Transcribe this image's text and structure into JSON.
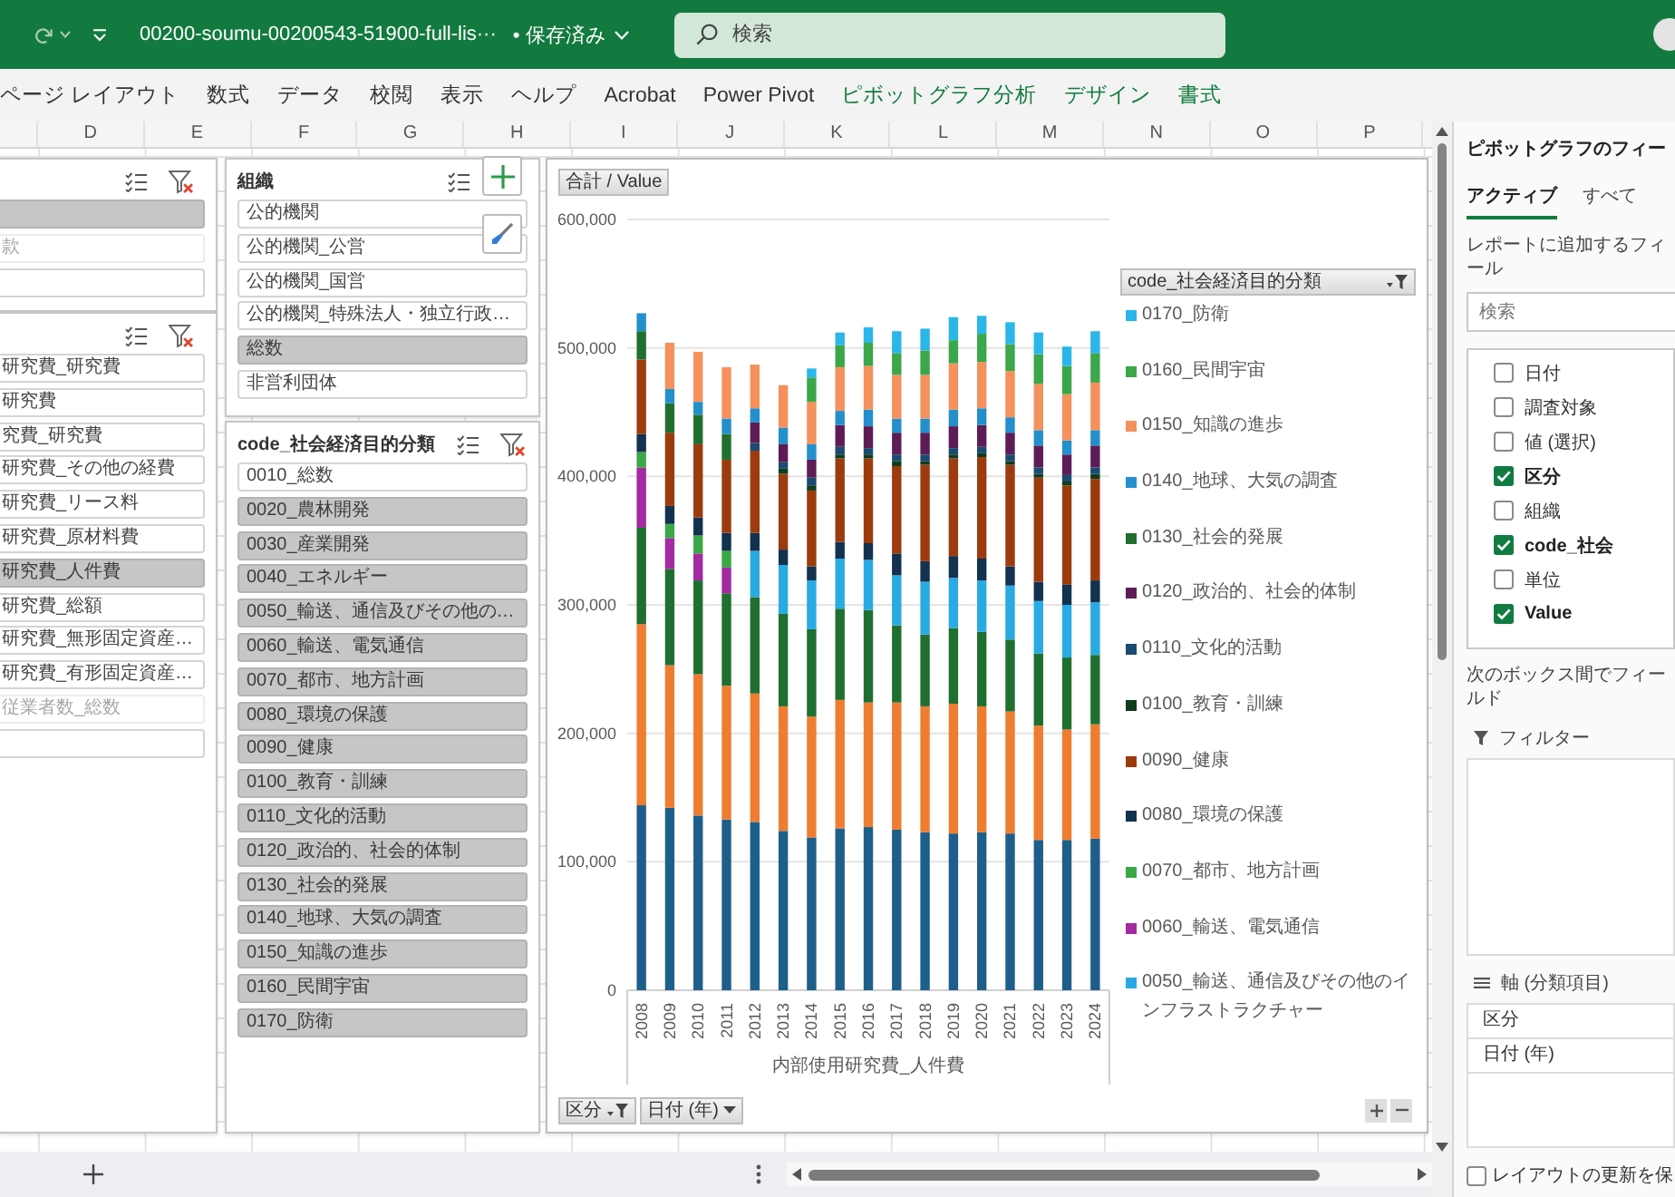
{
  "title_bar": {
    "file_name": "00200-soumu-00200543-51900-full-lis···",
    "save_status": "• 保存済み",
    "search": {
      "placeholder": "検索"
    }
  },
  "ribbon_tabs": [
    {
      "label": "ページ レイアウト",
      "contextual": false
    },
    {
      "label": "数式",
      "contextual": false
    },
    {
      "label": "データ",
      "contextual": false
    },
    {
      "label": "校閲",
      "contextual": false
    },
    {
      "label": "表示",
      "contextual": false
    },
    {
      "label": "ヘルプ",
      "contextual": false
    },
    {
      "label": "Acrobat",
      "contextual": false
    },
    {
      "label": "Power Pivot",
      "contextual": false
    },
    {
      "label": "ピボットグラフ分析",
      "contextual": true
    },
    {
      "label": "デザイン",
      "contextual": true
    },
    {
      "label": "書式",
      "contextual": true
    }
  ],
  "column_headers": [
    "D",
    "E",
    "F",
    "G",
    "H",
    "I",
    "J",
    "K",
    "L",
    "M",
    "N",
    "O",
    "P"
  ],
  "slicers": [
    {
      "items": [
        {
          "selected": true,
          "has_data": true
        },
        {
          "label": "款",
          "selected": false,
          "has_data": false
        },
        {
          "selected": false,
          "has_data": true
        }
      ]
    },
    {
      "items": [
        {
          "label": "研究費_研究費",
          "selected": false,
          "has_data": true
        },
        {
          "label": "研究費",
          "selected": false,
          "has_data": true
        },
        {
          "label": "究費_研究費",
          "selected": false,
          "has_data": true
        },
        {
          "label": "研究費_その他の経費",
          "selected": false,
          "has_data": true
        },
        {
          "label": "研究費_リース料",
          "selected": false,
          "has_data": true
        },
        {
          "label": "研究費_原材料費",
          "selected": false,
          "has_data": true
        },
        {
          "label": "研究費_人件費",
          "selected": true,
          "has_data": true
        },
        {
          "label": "研究費_総額",
          "selected": false,
          "has_data": true
        },
        {
          "label": "研究費_無形固定資産…",
          "selected": false,
          "has_data": true
        },
        {
          "label": "研究費_有形固定資産…",
          "selected": false,
          "has_data": true
        },
        {
          "label": "従業者数_総数",
          "selected": false,
          "has_data": false
        },
        {
          "selected": false,
          "has_data": true
        }
      ]
    },
    {
      "title": "組織",
      "items": [
        {
          "label": "公的機関",
          "selected": false,
          "has_data": true
        },
        {
          "label": "公的機関_公営",
          "selected": false,
          "has_data": true
        },
        {
          "label": "公的機関_国営",
          "selected": false,
          "has_data": true
        },
        {
          "label": "公的機関_特殊法人・独立行政…",
          "selected": false,
          "has_data": true
        },
        {
          "label": "総数",
          "selected": true,
          "has_data": true
        },
        {
          "label": "非営利団体",
          "selected": false,
          "has_data": true
        }
      ]
    },
    {
      "title": "code_社会経済目的分類",
      "items": [
        {
          "label": "0010_総数",
          "selected": false,
          "has_data": true
        },
        {
          "label": "0020_農林開発",
          "selected": true,
          "has_data": true
        },
        {
          "label": "0030_産業開発",
          "selected": true,
          "has_data": true
        },
        {
          "label": "0040_エネルギー",
          "selected": true,
          "has_data": true
        },
        {
          "label": "0050_輸送、通信及びその他の…",
          "selected": true,
          "has_data": true
        },
        {
          "label": "0060_輸送、電気通信",
          "selected": true,
          "has_data": true
        },
        {
          "label": "0070_都市、地方計画",
          "selected": true,
          "has_data": true
        },
        {
          "label": "0080_環境の保護",
          "selected": true,
          "has_data": true
        },
        {
          "label": "0090_健康",
          "selected": true,
          "has_data": true
        },
        {
          "label": "0100_教育・訓練",
          "selected": true,
          "has_data": true
        },
        {
          "label": "0110_文化的活動",
          "selected": true,
          "has_data": true
        },
        {
          "label": "0120_政治的、社会的体制",
          "selected": true,
          "has_data": true
        },
        {
          "label": "0130_社会的発展",
          "selected": true,
          "has_data": true
        },
        {
          "label": "0140_地球、大気の調査",
          "selected": true,
          "has_data": true
        },
        {
          "label": "0150_知識の進歩",
          "selected": true,
          "has_data": true
        },
        {
          "label": "0160_民間宇宙",
          "selected": true,
          "has_data": true
        },
        {
          "label": "0170_防衛",
          "selected": true,
          "has_data": true
        }
      ]
    }
  ],
  "chart": {
    "value_field_button": "合計 / Value",
    "legend_button": {
      "label": "code_社会経済目的分類",
      "filtered": true
    },
    "axis_buttons": [
      {
        "label": "区分",
        "filtered": true
      },
      {
        "label": "日付 (年)",
        "filtered": false
      }
    ],
    "chart_data": {
      "type": "bar",
      "orientation": "vertical",
      "stacked": true,
      "grid": true,
      "legend": "right",
      "xlabel": "内部使用研究費_人件費",
      "categories": [
        "2008",
        "2009",
        "2010",
        "2011",
        "2012",
        "2013",
        "2014",
        "2015",
        "2016",
        "2017",
        "2018",
        "2019",
        "2020",
        "2021",
        "2022",
        "2023",
        "2024"
      ],
      "ylim": [
        0,
        600000
      ],
      "yticks": [
        {
          "value": 0,
          "label": "0"
        },
        {
          "value": 100000,
          "label": "100,000"
        },
        {
          "value": 200000,
          "label": "200,000"
        },
        {
          "value": 300000,
          "label": "300,000"
        },
        {
          "value": 400000,
          "label": "400,000"
        },
        {
          "value": 500000,
          "label": "500,000"
        },
        {
          "value": 600000,
          "label": "600,000"
        }
      ],
      "series": [
        {
          "color": "#1d5f8a",
          "values": [
            144000,
            142000,
            136000,
            133000,
            131000,
            124000,
            119000,
            126000,
            127000,
            125000,
            123000,
            122000,
            123000,
            122000,
            117000,
            117000,
            118000
          ]
        },
        {
          "color": "#ee7d31",
          "values": [
            141000,
            111000,
            110000,
            104000,
            100000,
            97000,
            94000,
            100000,
            97000,
            99000,
            98000,
            101000,
            98000,
            95000,
            89000,
            86000,
            89000
          ]
        },
        {
          "color": "#1f6f30",
          "values": [
            75000,
            75000,
            73000,
            72000,
            75000,
            72000,
            68000,
            71000,
            72000,
            60000,
            56000,
            59000,
            58000,
            56000,
            56000,
            56000,
            54000
          ]
        },
        {
          "name": "0050_輸送、通信及びその他のインフラストラクチャー",
          "color": "#29aae2",
          "values": [
            null,
            null,
            null,
            null,
            36000,
            38000,
            38000,
            39000,
            39000,
            39000,
            41000,
            39000,
            40000,
            42000,
            41000,
            41000,
            41000
          ]
        },
        {
          "name": "0060_輸送、電気通信",
          "color": "#a32aa0",
          "values": [
            47000,
            24000,
            21000,
            20000,
            null,
            null,
            null,
            null,
            null,
            null,
            null,
            null,
            null,
            null,
            null,
            null,
            null
          ]
        },
        {
          "name": "0070_都市、地方計画",
          "color": "#3aa846",
          "values": [
            12000,
            11000,
            14000,
            13000,
            null,
            null,
            null,
            null,
            null,
            null,
            null,
            null,
            null,
            null,
            null,
            null,
            null
          ]
        },
        {
          "name": "0080_環境の保護",
          "color": "#12324f",
          "values": [
            14000,
            14000,
            14000,
            14000,
            14000,
            12000,
            11000,
            13000,
            13000,
            17000,
            16000,
            17000,
            17000,
            15000,
            15000,
            16000,
            17000
          ]
        },
        {
          "name": "0090_健康",
          "color": "#9c3b0e",
          "values": [
            58000,
            57000,
            57000,
            57000,
            64000,
            59000,
            59000,
            65000,
            66000,
            68000,
            75000,
            76000,
            79000,
            79000,
            81000,
            77000,
            79000
          ]
        },
        {
          "name": "0100_教育・訓練",
          "color": "#103c1c",
          "values": [
            null,
            null,
            null,
            null,
            null,
            4000,
            4000,
            3000,
            3000,
            4000,
            3000,
            3000,
            3000,
            3000,
            3000,
            3000,
            4000
          ]
        },
        {
          "name": "0110_文化的活動",
          "color": "#1a4b71",
          "values": [
            null,
            null,
            null,
            null,
            6000,
            5000,
            6000,
            6000,
            5000,
            5000,
            5000,
            5000,
            5000,
            5000,
            5000,
            5000,
            5000
          ]
        },
        {
          "name": "0120_政治的、社会的体制",
          "color": "#5d1c55",
          "values": [
            null,
            null,
            null,
            null,
            16000,
            14000,
            14000,
            17000,
            17000,
            17000,
            17000,
            17000,
            17000,
            17000,
            17000,
            16000,
            17000
          ]
        },
        {
          "name": "0130_社会的発展",
          "color": "#216f2e",
          "values": [
            22000,
            23000,
            23000,
            20000,
            null,
            null,
            null,
            null,
            null,
            null,
            null,
            null,
            null,
            null,
            null,
            null,
            null
          ]
        },
        {
          "name": "0140_地球、大気の調査",
          "color": "#2390cc",
          "values": [
            14000,
            11000,
            10000,
            12000,
            11000,
            13000,
            12000,
            11000,
            13000,
            11000,
            11000,
            13000,
            13000,
            12000,
            12000,
            11000,
            12000
          ]
        },
        {
          "name": "0150_知識の進歩",
          "color": "#f4915c",
          "values": [
            null,
            36000,
            39000,
            40000,
            34000,
            33000,
            33000,
            34000,
            34000,
            34000,
            34000,
            36000,
            36000,
            36000,
            36000,
            36000,
            37000
          ]
        },
        {
          "name": "0160_民間宇宙",
          "color": "#3ca64a",
          "values": [
            null,
            null,
            null,
            null,
            null,
            null,
            19000,
            17000,
            18000,
            17000,
            19000,
            18000,
            22000,
            21000,
            23000,
            22000,
            23000
          ]
        },
        {
          "name": "0170_防衛",
          "color": "#2bb6ea",
          "values": [
            null,
            null,
            null,
            null,
            null,
            null,
            7000,
            10000,
            12000,
            17000,
            17000,
            18000,
            14000,
            17000,
            17000,
            15000,
            17000
          ]
        }
      ]
    }
  },
  "field_pane": {
    "title": "ピボットグラフのフィー",
    "tabs": [
      {
        "label": "アクティブ",
        "selected": true
      },
      {
        "label": "すべて",
        "selected": false
      }
    ],
    "instruction": "レポートに追加するフィール",
    "search": {
      "placeholder": "検索"
    },
    "fields": [
      {
        "label": "日付",
        "checked": false
      },
      {
        "label": "調査対象",
        "checked": false
      },
      {
        "label": "値 (選択)",
        "checked": false
      },
      {
        "label": "区分",
        "checked": true
      },
      {
        "label": "組織",
        "checked": false
      },
      {
        "label": "code_社会",
        "checked": true
      },
      {
        "label": "単位",
        "checked": false
      },
      {
        "label": "Value",
        "checked": true
      }
    ],
    "areas_instruction": "次のボックス間でフィールド",
    "filter_area": {
      "title": "フィルター"
    },
    "axis_area": {
      "title": "軸 (分類項目)",
      "items": [
        "区分",
        "日付 (年)"
      ]
    },
    "defer_update": {
      "label": "レイアウトの更新を保",
      "checked": false
    }
  }
}
